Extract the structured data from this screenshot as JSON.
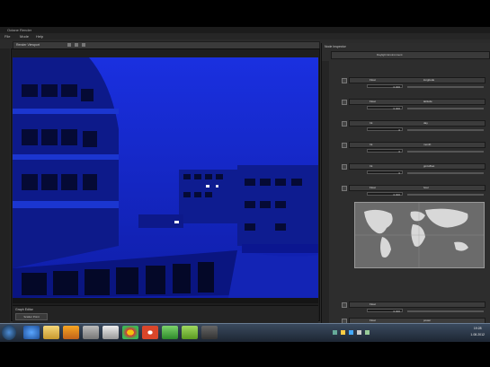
{
  "window": {
    "title": "Octane Render"
  },
  "menu": [
    "File",
    "Mode",
    "Help"
  ],
  "viewport": {
    "title": "Render Viewport"
  },
  "console": {
    "title": "Graph Editor",
    "tab": "Scatter Point"
  },
  "nodes": {
    "title": "Node Inspector",
    "mode_label": "Daylight Environment"
  },
  "properties": [
    {
      "label": "Float",
      "sub": "longitude",
      "value": "0.000"
    },
    {
      "label": "Float",
      "sub": "latitude",
      "value": "0.000"
    },
    {
      "label": "Int",
      "sub": "day",
      "value": "0"
    },
    {
      "label": "Int",
      "sub": "month",
      "value": "0"
    },
    {
      "label": "Int",
      "sub": "gmtoffset",
      "value": "0"
    },
    {
      "label": "Float",
      "sub": "hour",
      "value": "0.000"
    }
  ],
  "lower_properties": [
    {
      "label": "Float",
      "sub": "",
      "value": "0.000"
    },
    {
      "label": "Float",
      "sub": "power",
      "value": "0.000"
    }
  ],
  "colors": {
    "sky": "#1a2cd8",
    "panel": "#2d2d2d",
    "taskbar": "#243043"
  },
  "taskbar": {
    "icons": [
      "windows-orb",
      "internet-explorer-icon",
      "folder-icon",
      "media-player-icon",
      "app-icon-1",
      "app-icon-2",
      "chrome-icon",
      "utorrent-icon",
      "app-icon-3",
      "app-icon-4",
      "app-icon-5"
    ],
    "time": "19:28",
    "date": "1.08.2012"
  }
}
